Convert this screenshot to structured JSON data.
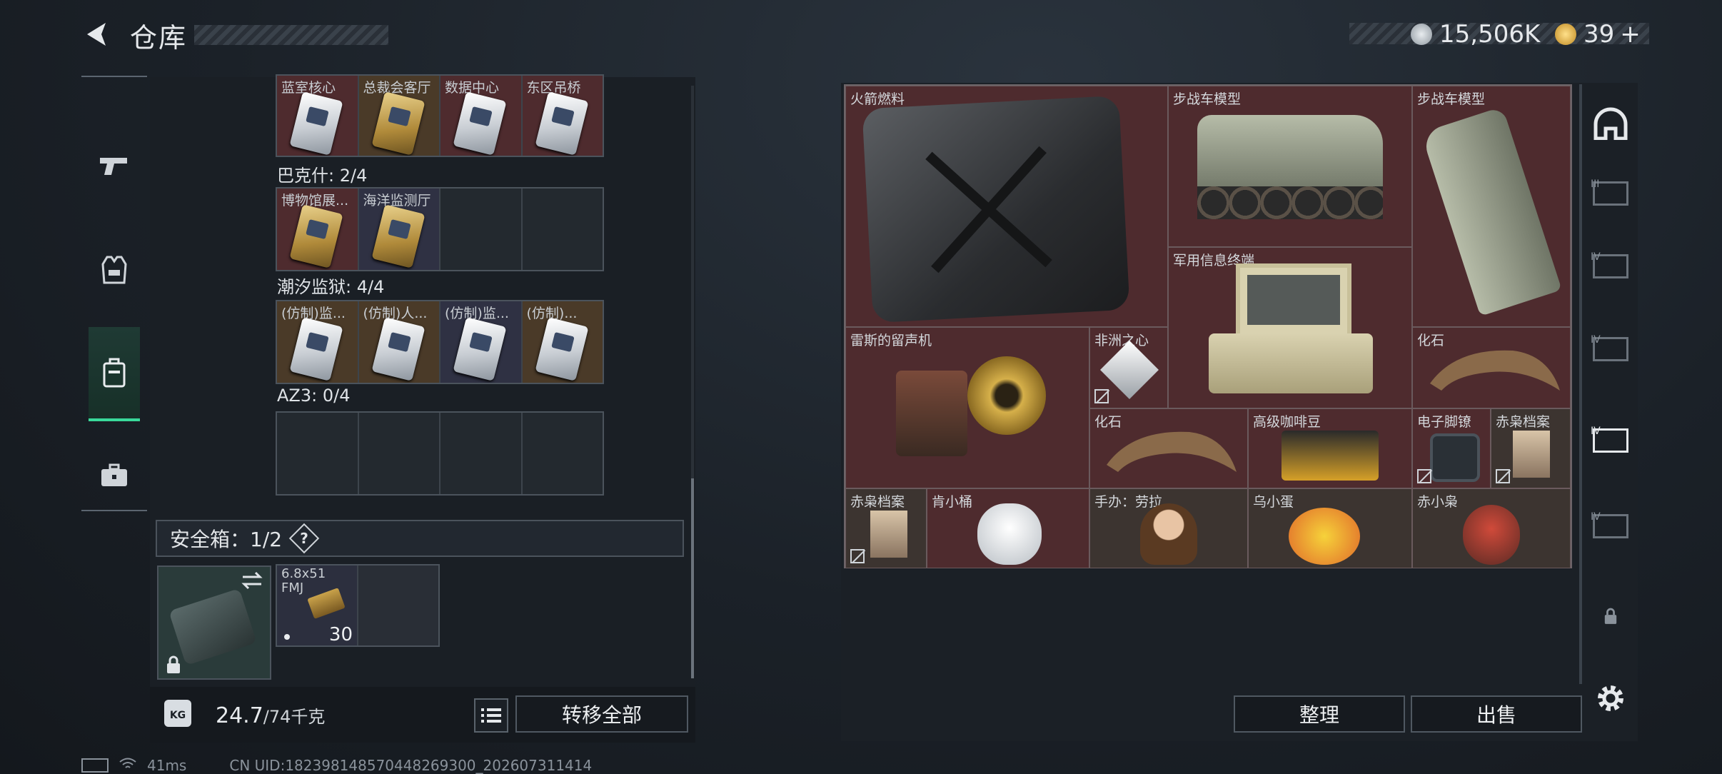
{
  "header": {
    "title": "仓库",
    "currency1_value": "15,506K",
    "currency2_value": "39",
    "currency2_plus": "+"
  },
  "left_tabs": [
    {
      "icon": "pistol-icon"
    },
    {
      "icon": "vest-icon"
    },
    {
      "icon": "backpack-icon",
      "active": true
    },
    {
      "icon": "briefcase-icon"
    }
  ],
  "groups": [
    {
      "label": "",
      "cards": [
        "蓝室核心",
        "总裁会客厅",
        "数据中心",
        "东区吊桥"
      ]
    },
    {
      "label": "巴克什: 2/4",
      "cards": [
        "博物馆展...",
        "海洋监测厅",
        "",
        ""
      ]
    },
    {
      "label": "潮汐监狱: 4/4",
      "cards": [
        "(仿制)监...",
        "(仿制)人...",
        "(仿制)监...",
        "(仿制)..."
      ]
    },
    {
      "label": "AZ3: 0/4",
      "cards": [
        "",
        "",
        "",
        ""
      ]
    }
  ],
  "safe": {
    "label": "安全箱：1/2",
    "help": "?",
    "ammo_name": "6.8x51 FMJ",
    "ammo_count": "30"
  },
  "footer": {
    "weight_icon": "KG",
    "weight_current": "24.7",
    "weight_max": "/74千克",
    "transfer_all": "转移全部",
    "sort": "整理",
    "sell": "出售"
  },
  "right_items": [
    {
      "name": "火箭燃料"
    },
    {
      "name": "步战车模型"
    },
    {
      "name": "步战车模型"
    },
    {
      "name": "军用信息终端"
    },
    {
      "name": "雷斯的留声机"
    },
    {
      "name": "非洲之心"
    },
    {
      "name": "化石"
    },
    {
      "name": "化石"
    },
    {
      "name": "高级咖啡豆"
    },
    {
      "name": "电子脚镣"
    },
    {
      "name": "赤枭档案"
    },
    {
      "name": "赤枭档案"
    },
    {
      "name": "肯小桶"
    },
    {
      "name": "手办：劳拉"
    },
    {
      "name": "乌小蛋"
    },
    {
      "name": "赤小枭"
    }
  ],
  "right_tabs": [
    "helmet-icon",
    "III",
    "IV",
    "IV",
    "IV",
    "IV",
    "lock-icon",
    "settings-icon"
  ],
  "status_bar": {
    "ping": "41ms",
    "uid": "CN UID:182398148570448269300_202607311414"
  },
  "colors": {
    "accent": "#39d99a",
    "item_red": "#4e2b2e",
    "item_brown": "#3c3430"
  }
}
